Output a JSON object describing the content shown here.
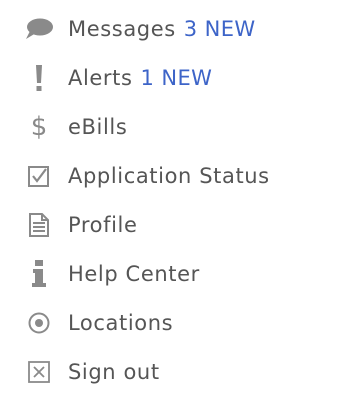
{
  "menu": {
    "items": [
      {
        "icon": "speech-bubble-icon",
        "label": "Messages",
        "badge": "3 NEW"
      },
      {
        "icon": "exclamation-icon",
        "label": "Alerts",
        "badge": "1 NEW"
      },
      {
        "icon": "dollar-icon",
        "label": "eBills"
      },
      {
        "icon": "checkbox-checked-icon",
        "label": "Application Status"
      },
      {
        "icon": "document-icon",
        "label": "Profile"
      },
      {
        "icon": "info-icon",
        "label": "Help Center"
      },
      {
        "icon": "location-target-icon",
        "label": "Locations"
      },
      {
        "icon": "close-box-icon",
        "label": "Sign out"
      }
    ]
  },
  "colors": {
    "text": "#555555",
    "accent": "#3d64c8",
    "icon": "#8a8a8a"
  }
}
